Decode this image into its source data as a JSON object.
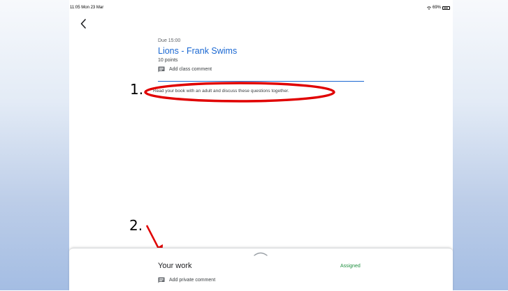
{
  "status_bar": {
    "time": "11:05 Mon 23 Mar",
    "battery": "69%"
  },
  "assignment": {
    "due": "Due 15:00",
    "title": "Lions - Frank Swims",
    "points": "10 points",
    "class_comment": "Add class comment",
    "instructions": "Read your book with an adult and discuss these questions together."
  },
  "annotations": {
    "label1": "1.",
    "label2": "2.",
    "color": "#e00000"
  },
  "your_work": {
    "heading": "Your work",
    "status": "Assigned",
    "private_comment": "Add private comment"
  },
  "colors": {
    "accent": "#1967d2",
    "assigned": "#1e8e3e"
  },
  "icons": {
    "back": "chevron-left-icon",
    "comment": "comment-icon",
    "wifi": "wifi-icon",
    "battery": "battery-icon",
    "handle": "expand-handle-icon"
  }
}
